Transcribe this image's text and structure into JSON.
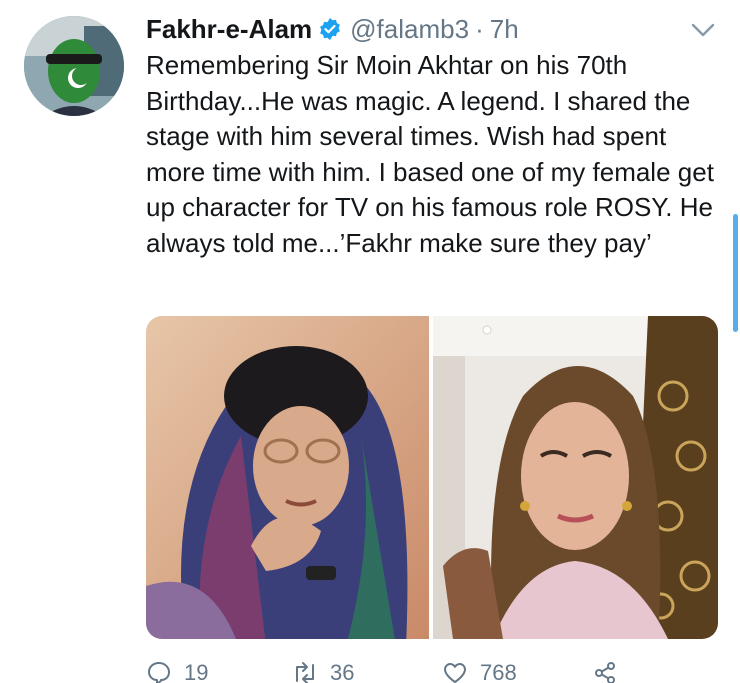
{
  "tweet": {
    "display_name": "Fakhr-e-Alam",
    "handle": "@falamb3",
    "separator": "·",
    "time": "7h",
    "text": "Remembering Sir Moin Akhtar on his 70th Birthday...He was magic. A legend. I shared the stage with him several times. Wish had spent more time with him. I based one of my female get up character for TV on his famous role ROSY. He always told me...’Fakhr make sure they pay’",
    "verified": true
  },
  "icons": {
    "avatar": "avatar",
    "verified": "verified-badge-icon",
    "caret": "chevron-down-icon",
    "reply": "reply-icon",
    "retweet": "retweet-icon",
    "like": "heart-icon",
    "share": "share-icon"
  },
  "media": {
    "photos": [
      "photo-left",
      "photo-right"
    ]
  },
  "actions": {
    "reply_count": "19",
    "retweet_count": "36",
    "like_count": "768"
  },
  "colors": {
    "text": "#14171a",
    "secondary": "#657786",
    "accent": "#1da1f2"
  }
}
